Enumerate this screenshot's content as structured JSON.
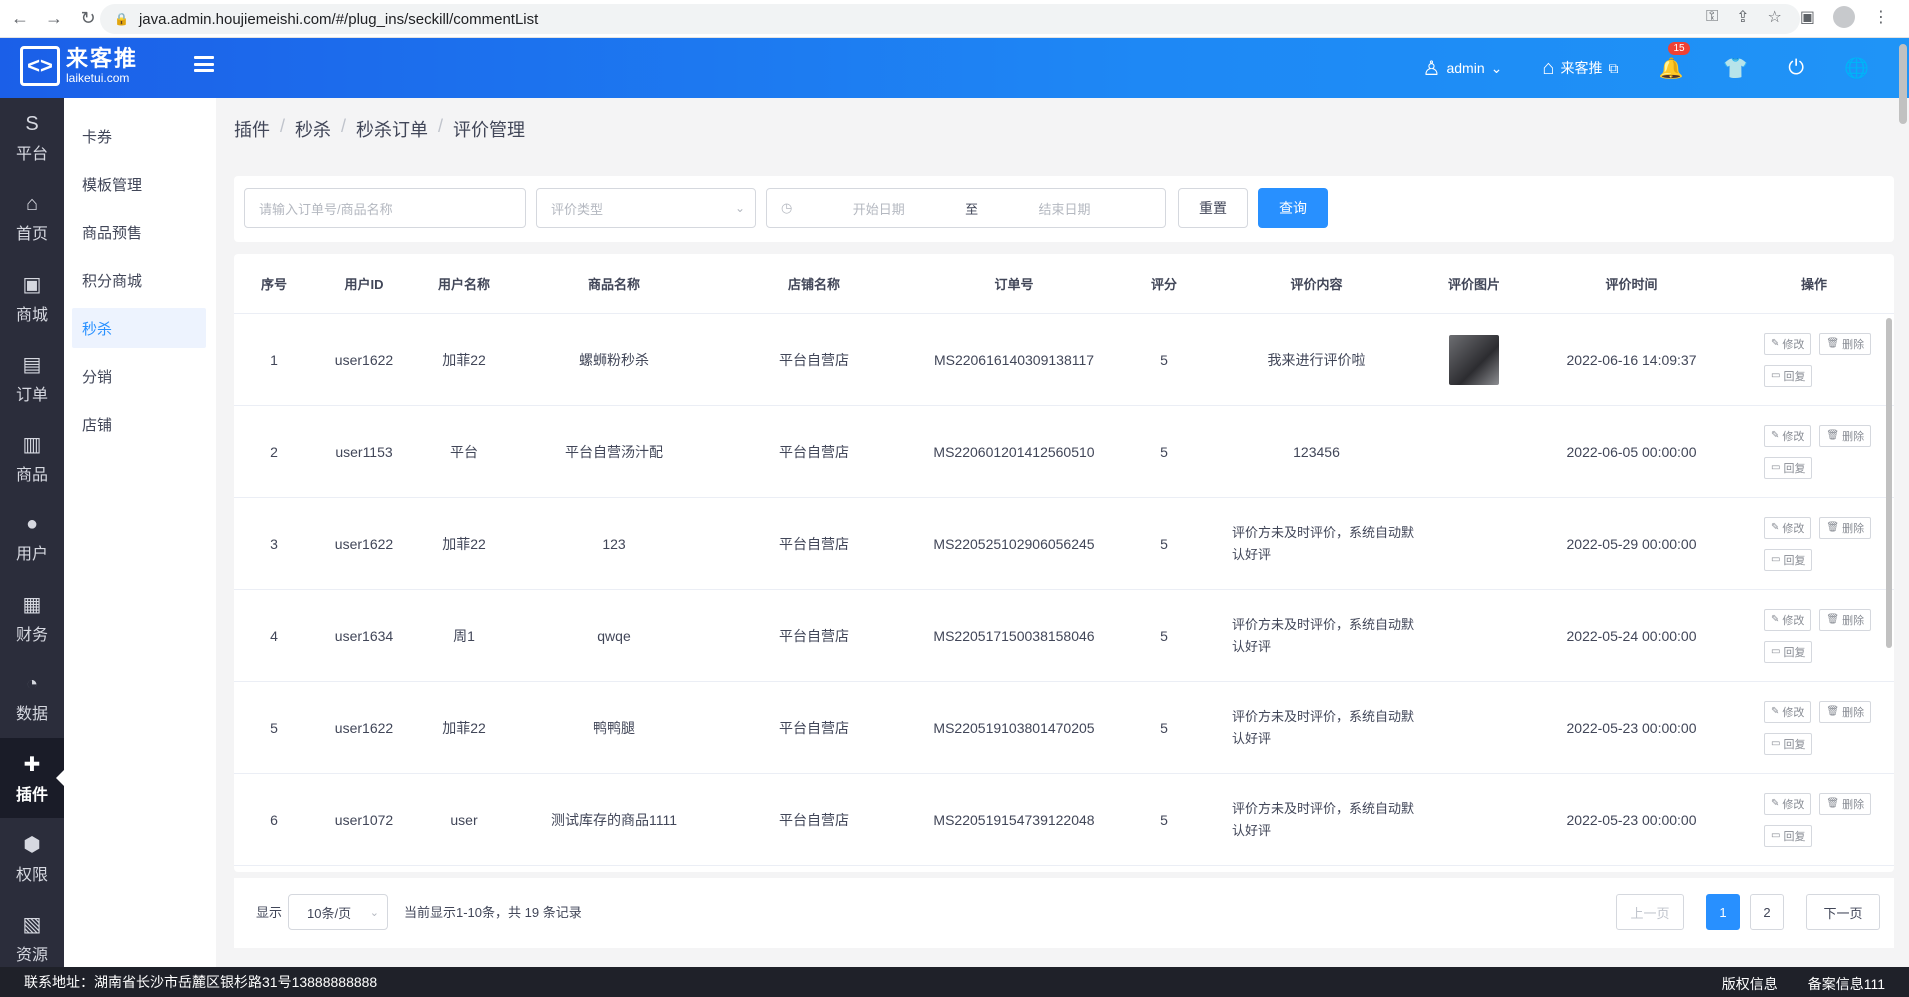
{
  "browser": {
    "url": "java.admin.houjiemeishi.com/#/plug_ins/seckill/commentList"
  },
  "header": {
    "logo_cn": "来客推",
    "logo_en": "laiketui.com",
    "user": "admin",
    "shop_link": "来客推",
    "notification_count": "15"
  },
  "left_nav": [
    {
      "label": "平台",
      "icon": "S"
    },
    {
      "label": "首页",
      "icon": "⌂"
    },
    {
      "label": "商城",
      "icon": "▣"
    },
    {
      "label": "订单",
      "icon": "▤"
    },
    {
      "label": "商品",
      "icon": "▥"
    },
    {
      "label": "用户",
      "icon": "●"
    },
    {
      "label": "财务",
      "icon": "▦"
    },
    {
      "label": "数据",
      "icon": "◔"
    },
    {
      "label": "插件",
      "icon": "✚"
    },
    {
      "label": "权限",
      "icon": "⬢"
    },
    {
      "label": "资源",
      "icon": "▧"
    }
  ],
  "sub_nav": [
    {
      "label": "卡券"
    },
    {
      "label": "模板管理"
    },
    {
      "label": "商品预售"
    },
    {
      "label": "积分商城"
    },
    {
      "label": "秒杀"
    },
    {
      "label": "分销"
    },
    {
      "label": "店铺"
    }
  ],
  "breadcrumb": [
    "插件",
    "秒杀",
    "秒杀订单",
    "评价管理"
  ],
  "filters": {
    "search_placeholder": "请输入订单号/商品名称",
    "type_placeholder": "评价类型",
    "start_placeholder": "开始日期",
    "to_label": "至",
    "end_placeholder": "结束日期",
    "reset_label": "重置",
    "query_label": "查询"
  },
  "table": {
    "columns": [
      "序号",
      "用户ID",
      "用户名称",
      "商品名称",
      "店铺名称",
      "订单号",
      "评分",
      "评价内容",
      "评价图片",
      "评价时间",
      "操作"
    ],
    "rows": [
      {
        "idx": "1",
        "uid": "user1622",
        "uname": "加菲22",
        "goods": "螺蛳粉秒杀",
        "shop": "平台自营店",
        "order": "MS220616140309138117",
        "score": "5",
        "content": "我来进行评价啦",
        "has_img": true,
        "time": "2022-06-16 14:09:37"
      },
      {
        "idx": "2",
        "uid": "user1153",
        "uname": "平台",
        "goods": "平台自营汤汁配",
        "shop": "平台自营店",
        "order": "MS220601201412560510",
        "score": "5",
        "content": "123456",
        "has_img": false,
        "time": "2022-06-05 00:00:00"
      },
      {
        "idx": "3",
        "uid": "user1622",
        "uname": "加菲22",
        "goods": "123",
        "shop": "平台自营店",
        "order": "MS220525102906056245",
        "score": "5",
        "content": "评价方未及时评价，系统自动默认好评",
        "has_img": false,
        "time": "2022-05-29 00:00:00"
      },
      {
        "idx": "4",
        "uid": "user1634",
        "uname": "周1",
        "goods": "qwqe",
        "shop": "平台自营店",
        "order": "MS220517150038158046",
        "score": "5",
        "content": "评价方未及时评价，系统自动默认好评",
        "has_img": false,
        "time": "2022-05-24 00:00:00"
      },
      {
        "idx": "5",
        "uid": "user1622",
        "uname": "加菲22",
        "goods": "鸭鸭腿",
        "shop": "平台自营店",
        "order": "MS220519103801470205",
        "score": "5",
        "content": "评价方未及时评价，系统自动默认好评",
        "has_img": false,
        "time": "2022-05-23 00:00:00"
      },
      {
        "idx": "6",
        "uid": "user1072",
        "uname": "user",
        "goods": "测试库存的商品1111",
        "shop": "平台自营店",
        "order": "MS220519154739122048",
        "score": "5",
        "content": "评价方未及时评价，系统自动默认好评",
        "has_img": false,
        "time": "2022-05-23 00:00:00"
      }
    ],
    "op_edit": "修改",
    "op_delete": "删除",
    "op_reply": "回复"
  },
  "pagination": {
    "show_label": "显示",
    "page_size": "10条/页",
    "summary": "当前显示1-10条，共 19 条记录",
    "prev": "上一页",
    "pages": [
      "1",
      "2"
    ],
    "next": "下一页"
  },
  "footer": {
    "address": "联系地址：湖南省长沙市岳麓区银杉路31号13888888888",
    "copyright": "版权信息",
    "icp": "备案信息111"
  },
  "colors": {
    "primary": "#2890ff",
    "header_start": "#1b5fe8",
    "sidebar": "#2b2d3b"
  }
}
